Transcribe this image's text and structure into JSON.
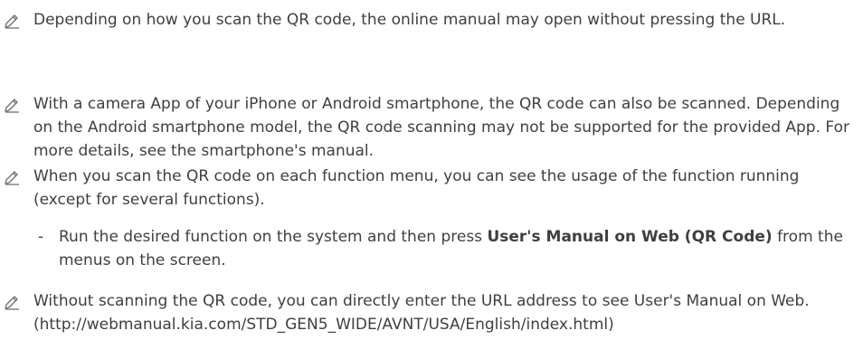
{
  "notes": [
    {
      "icon": "pencil-note-icon",
      "text": "Depending on how you scan the QR code, the online manual may open without pressing the URL."
    },
    {
      "icon": "pencil-note-icon",
      "text": "With a camera App of your iPhone or Android smartphone, the QR code can also be scanned. Depending on the Android smartphone model, the QR code scanning may not be supported for the provided App. For more details, see the smartphone's manual."
    },
    {
      "icon": "pencil-note-icon",
      "text": "When you scan the QR code on each function menu, you can see the usage of the function running (except for several functions).",
      "sub": {
        "bullet": "-",
        "prefix": "Run the desired function on the system and then press ",
        "bold": "User's Manual on Web (QR Code)",
        "suffix": " from the menus on the screen."
      }
    },
    {
      "icon": "pencil-note-icon",
      "text": "Without scanning the QR code, you can directly enter the URL address to see User's Manual on Web. (http://webmanual.kia.com/STD_GEN5_WIDE/AVNT/USA/English/index.html)"
    }
  ],
  "colors": {
    "text": "#3f3f3f",
    "icon": "#6e6e6e"
  }
}
